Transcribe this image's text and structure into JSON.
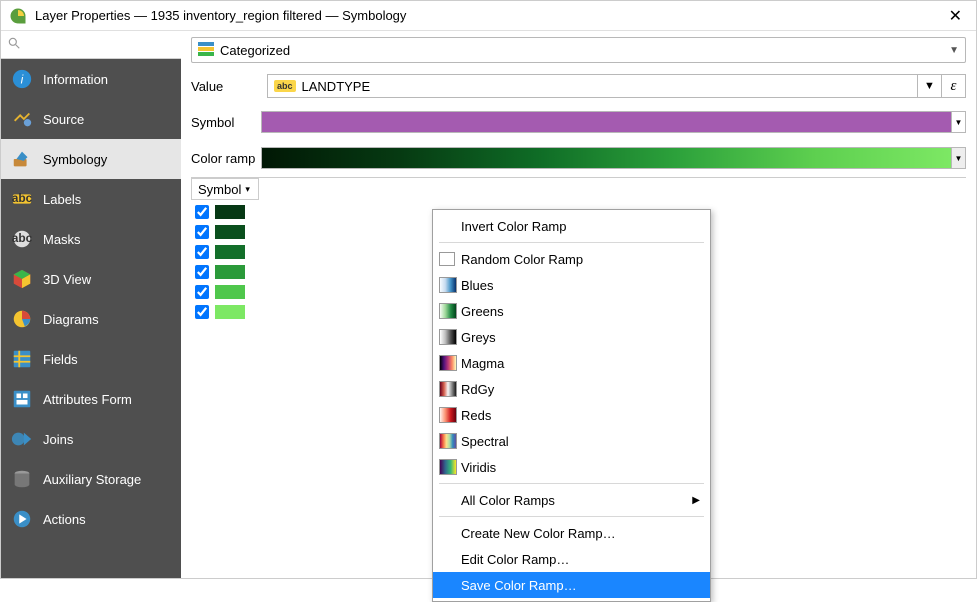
{
  "title": "Layer Properties — 1935 inventory_region filtered — Symbology",
  "search_placeholder": "",
  "sidebar": {
    "items": [
      {
        "label": "Information"
      },
      {
        "label": "Source"
      },
      {
        "label": "Symbology"
      },
      {
        "label": "Labels"
      },
      {
        "label": "Masks"
      },
      {
        "label": "3D View"
      },
      {
        "label": "Diagrams"
      },
      {
        "label": "Fields"
      },
      {
        "label": "Attributes Form"
      },
      {
        "label": "Joins"
      },
      {
        "label": "Auxiliary Storage"
      },
      {
        "label": "Actions"
      }
    ]
  },
  "renderer_label": "Categorized",
  "value_label": "Value",
  "value_field": "LANDTYPE",
  "symbol_label": "Symbol",
  "symbol_color": "#a45bb0",
  "ramp_label": "Color ramp",
  "table_header_symbol": "Symbol",
  "categories": [
    {
      "checked": true,
      "color": "#063814"
    },
    {
      "checked": true,
      "color": "#0a4f1d"
    },
    {
      "checked": true,
      "color": "#136f2a"
    },
    {
      "checked": true,
      "color": "#2b9a3a"
    },
    {
      "checked": true,
      "color": "#4fc74c"
    },
    {
      "checked": true,
      "color": "#7de864"
    }
  ],
  "popup": {
    "invert": "Invert Color Ramp",
    "random": "Random Color Ramp",
    "ramps": [
      {
        "name": "Blues",
        "grad": "linear-gradient(to right,#f7fbff,#c6dbef,#4292c6,#08306b)"
      },
      {
        "name": "Greens",
        "grad": "linear-gradient(to right,#f7fcf5,#a1d99b,#238b45,#00441b)"
      },
      {
        "name": "Greys",
        "grad": "linear-gradient(to right,#ffffff,#bdbdbd,#525252,#000000)"
      },
      {
        "name": "Magma",
        "grad": "linear-gradient(to right,#000004,#51127c,#b63679,#fb8861,#fcfdbf)"
      },
      {
        "name": "RdGy",
        "grad": "linear-gradient(to right,#67001f,#d6604d,#f7f7f7,#878787,#1a1a1a)"
      },
      {
        "name": "Reds",
        "grad": "linear-gradient(to right,#fff5f0,#fc9272,#cb181d,#67000d)"
      },
      {
        "name": "Spectral",
        "grad": "linear-gradient(to right,#9e0142,#f46d43,#fee08b,#abdda4,#3288bd,#5e4fa2)"
      },
      {
        "name": "Viridis",
        "grad": "linear-gradient(to right,#440154,#31688e,#35b779,#fde725)"
      }
    ],
    "all": "All Color Ramps",
    "create": "Create New Color Ramp…",
    "edit": "Edit Color Ramp…",
    "save": "Save Color Ramp…"
  }
}
